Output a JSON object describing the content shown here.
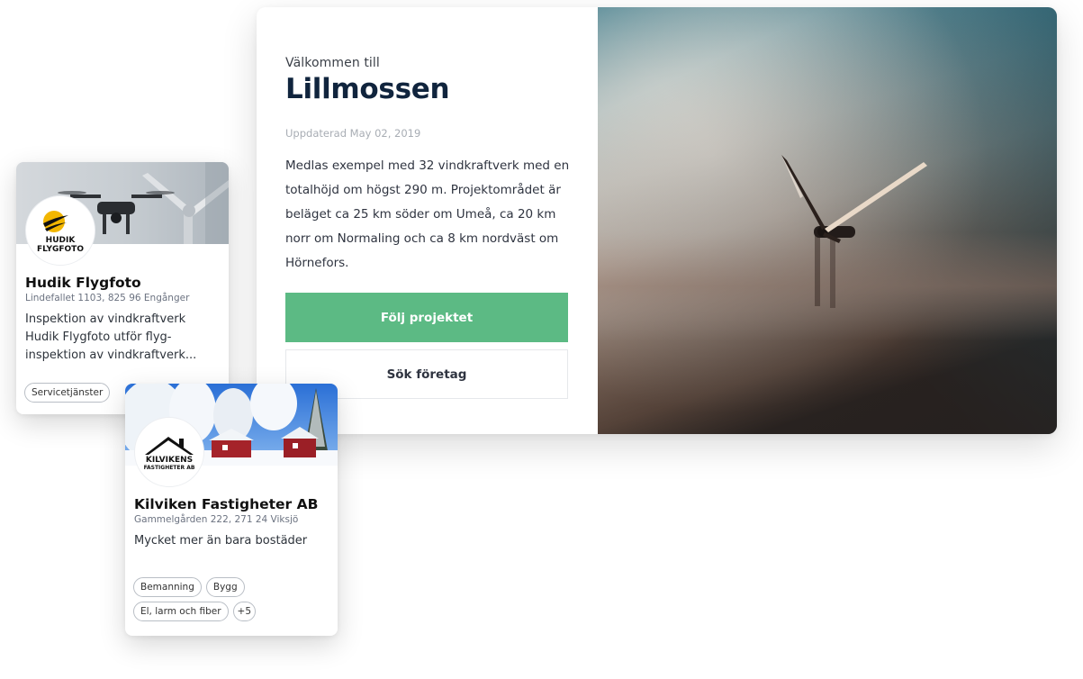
{
  "project": {
    "welcome": "Välkommen till",
    "title": "Lillmossen",
    "updated": "Uppdaterad May 02, 2019",
    "description": "Medlas exempel med 32 vindkraftverk med en totalhöjd om högst 290 m. Projektområdet är beläget ca 25 km söder om Umeå, ca 20 km norr om Normaling och ca 8 km nordväst om Hörnefors.",
    "follow_label": "Följ projektet",
    "search_label": "Sök företag",
    "photo_icon": "wind-turbine-in-fog",
    "accent_color": "#5cba84",
    "title_color": "#10243d"
  },
  "companies": [
    {
      "name": "Hudik Flygfoto",
      "address": "Lindefallet 1103, 825 96 Engånger",
      "description": "Inspektion av vindkraftverk Hudik Flygfoto utför flyg-inspektion av vindkraftverk...",
      "logo_text": "HUDIK FLYGFOTO",
      "banner": "drone-and-turbine",
      "tags": [
        "Servicetjänster"
      ]
    },
    {
      "name": "Kilviken Fastigheter AB",
      "address": "Gammelgården 222, 271 24 Viksjö",
      "description": "Mycket mer än bara bostäder",
      "logo_text": "KILVIKENS FASTIGHETER AB",
      "banner": "snowy-red-houses",
      "tags": [
        "Bemanning",
        "Bygg",
        "El, larm och fiber"
      ],
      "more_tags": "+5"
    }
  ]
}
